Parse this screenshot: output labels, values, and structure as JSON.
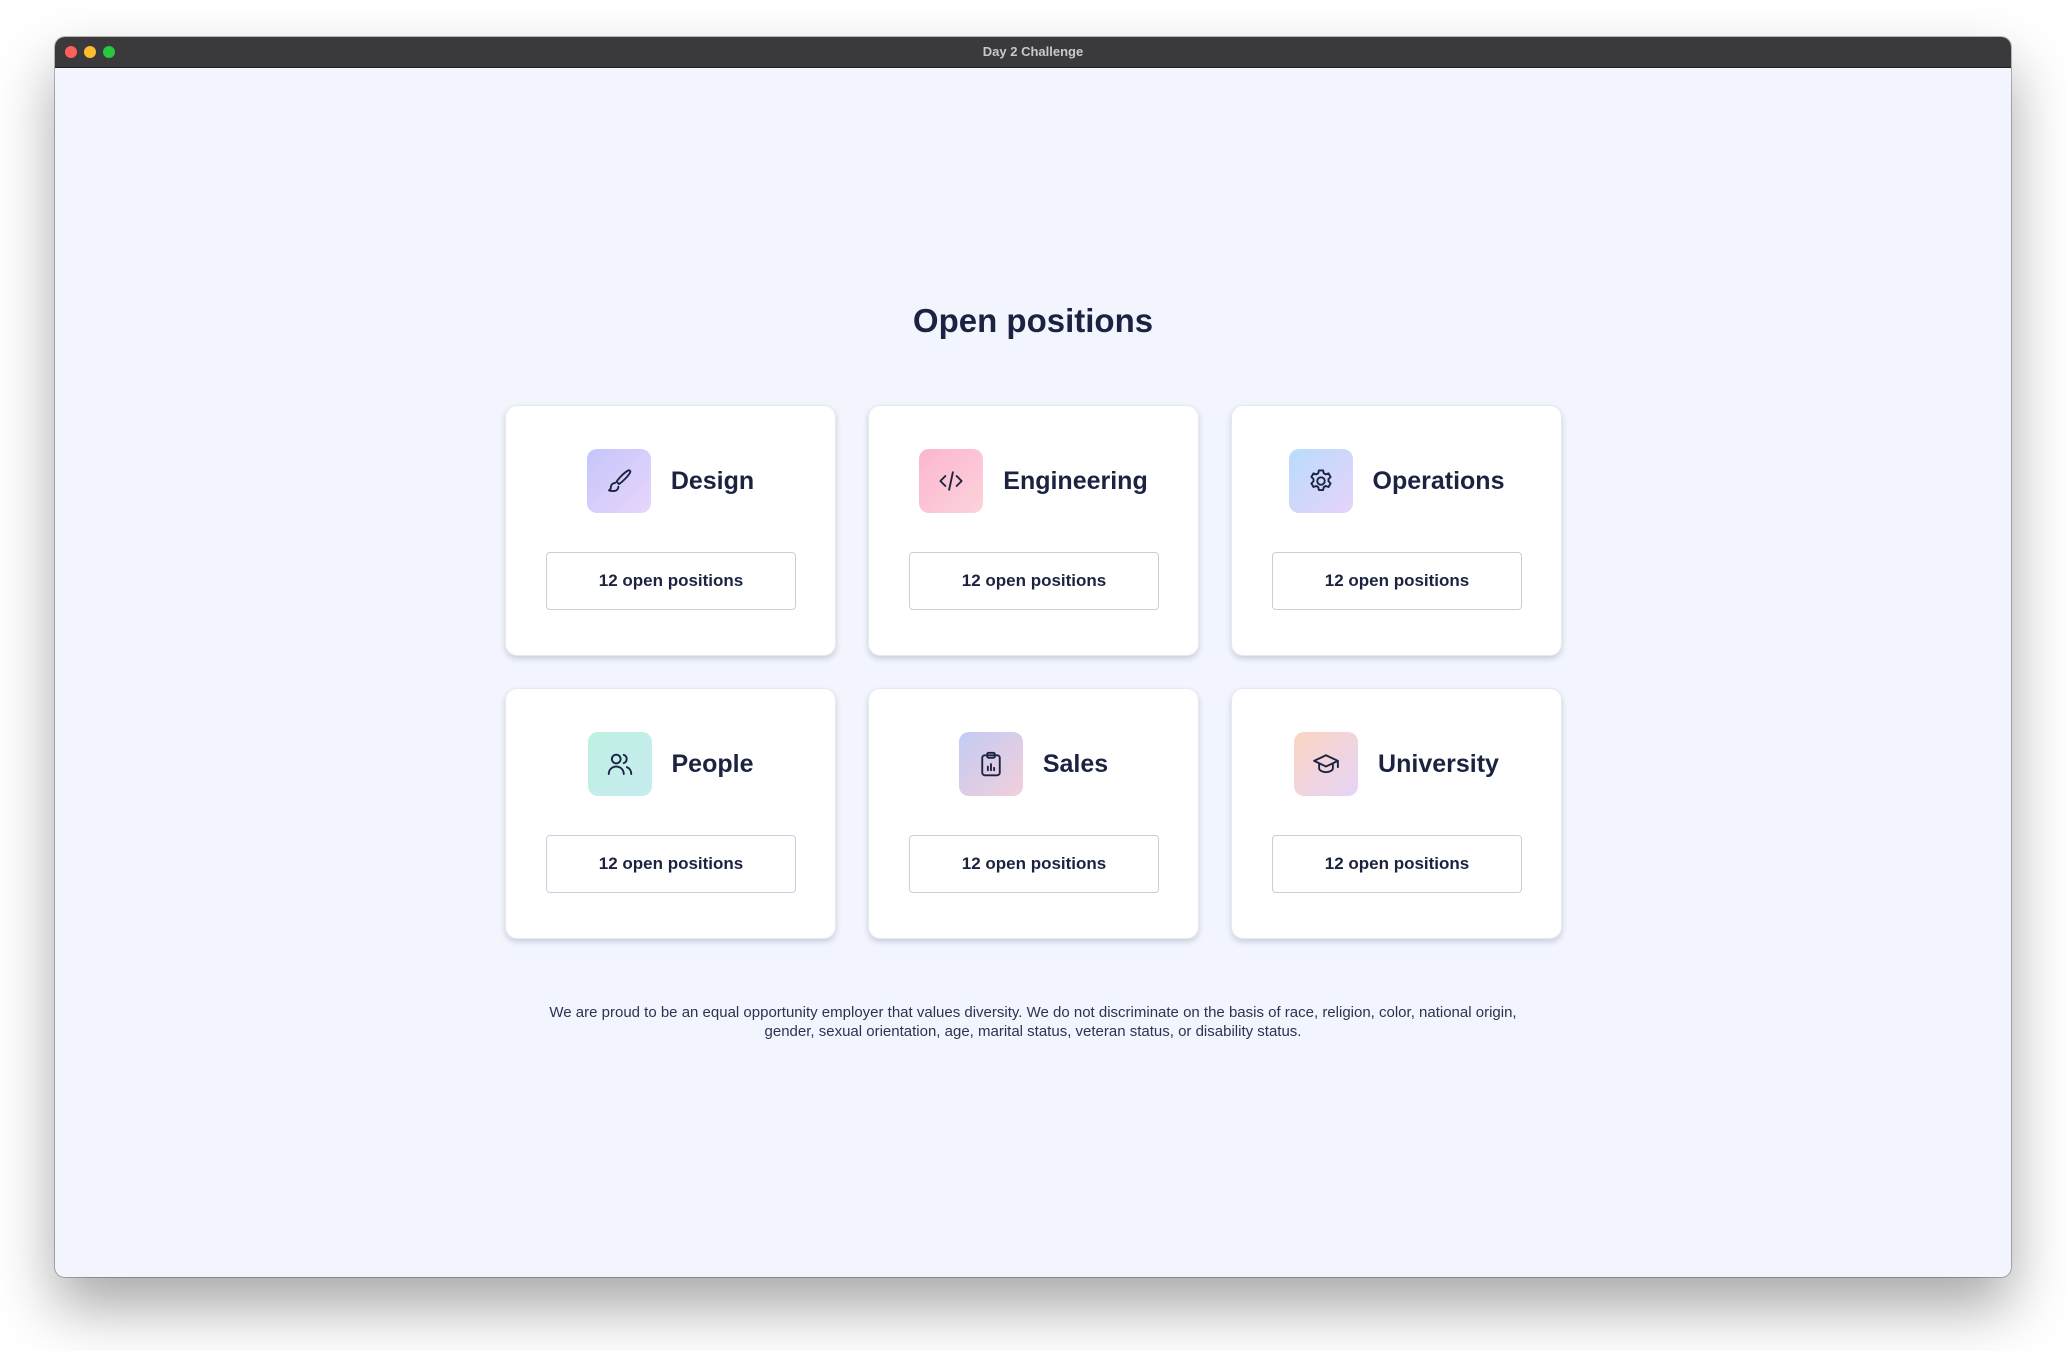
{
  "window": {
    "title": "Day 2 Challenge"
  },
  "page": {
    "title": "Open positions"
  },
  "departments": [
    {
      "name": "Design",
      "icon": "brush-icon",
      "positions_label": "12 open positions"
    },
    {
      "name": "Engineering",
      "icon": "code-icon",
      "positions_label": "12 open positions"
    },
    {
      "name": "Operations",
      "icon": "gear-icon",
      "positions_label": "12 open positions"
    },
    {
      "name": "People",
      "icon": "users-icon",
      "positions_label": "12 open positions"
    },
    {
      "name": "Sales",
      "icon": "clipboard-chart-icon",
      "positions_label": "12 open positions"
    },
    {
      "name": "University",
      "icon": "graduation-cap-icon",
      "positions_label": "12 open positions"
    }
  ],
  "footer": {
    "line1": "We are proud to be an equal opportunity employer that values diversity. We do not discriminate on the basis of race, religion, color, national origin,",
    "line2": "gender, sexual orientation, age, marital status, veteran status, or disability status."
  },
  "colors": {
    "background": "#f2f5fd",
    "text": "#1c2340",
    "titlebar": "#3a3a3c"
  }
}
